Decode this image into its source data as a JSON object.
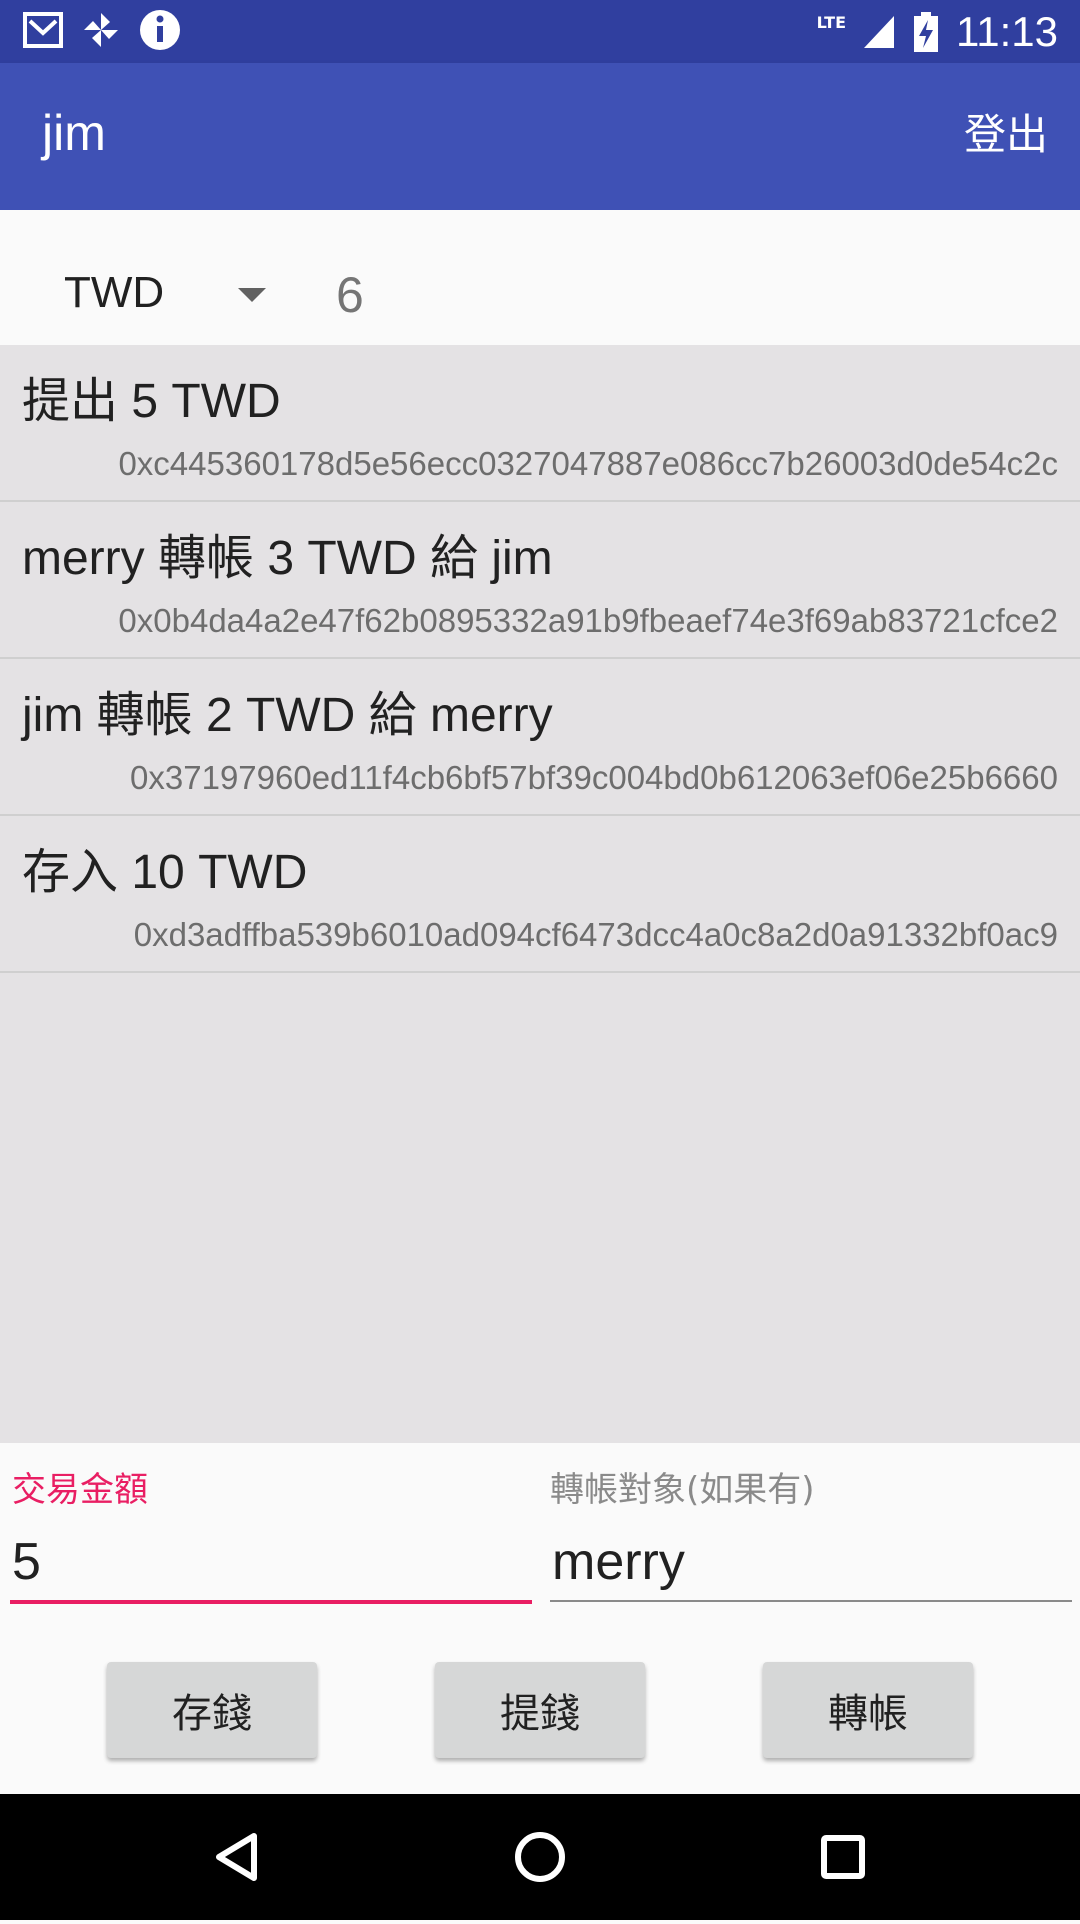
{
  "status_bar": {
    "time": "11:13",
    "network": "LTE",
    "icons": [
      "gmail-icon",
      "pinwheel-icon",
      "info-icon",
      "signal-icon",
      "battery-charging-icon"
    ]
  },
  "app_bar": {
    "title": "jim",
    "logout_label": "登出"
  },
  "filter": {
    "currency": "TWD",
    "count": "6"
  },
  "transactions": [
    {
      "title": "提出 5 TWD",
      "hash": "0xc445360178d5e56ecc0327047887e086cc7b26003d0de54c2c"
    },
    {
      "title": "merry 轉帳 3 TWD 給 jim",
      "hash": "0x0b4da4a2e47f62b0895332a91b9fbeaef74e3f69ab83721cfce2"
    },
    {
      "title": "jim 轉帳 2 TWD 給 merry",
      "hash": "0x37197960ed11f4cb6bf57bf39c004bd0b612063ef06e25b6660"
    },
    {
      "title": "存入 10 TWD",
      "hash": "0xd3adffba539b6010ad094cf6473dcc4a0c8a2d0a91332bf0ac9"
    }
  ],
  "form": {
    "amount_label": "交易金額",
    "amount_value": "5",
    "target_label": "轉帳對象(如果有)",
    "target_value": "merry"
  },
  "buttons": {
    "deposit": "存錢",
    "withdraw": "提錢",
    "transfer": "轉帳"
  },
  "colors": {
    "status_bar": "#303f9f",
    "app_bar": "#3f51b5",
    "accent": "#e91e63"
  }
}
